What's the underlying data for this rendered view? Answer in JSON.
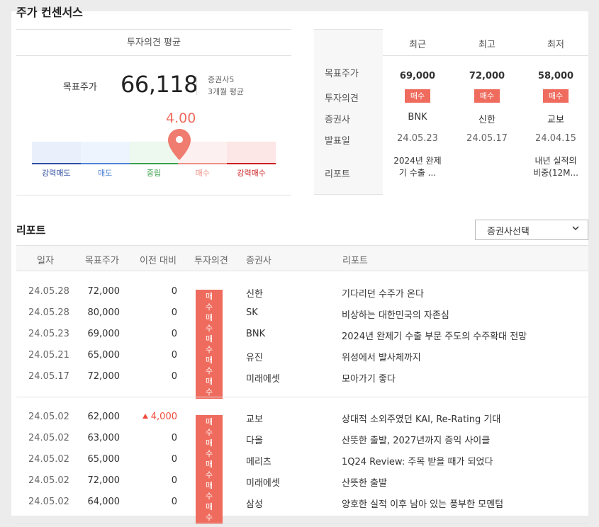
{
  "section_title": "주가 컨센서스",
  "consensus": {
    "header": "투자의견 평균",
    "target_label": "목표주가",
    "target_value": "66,118",
    "broker_count": "증권사5",
    "period": "3개월 평균",
    "score": "4.00",
    "score_fraction": 0.605,
    "scale": [
      {
        "label": "강력매도",
        "bg": "#e9f0fb",
        "line": "#2f4fa0",
        "text": "#2f4fa0"
      },
      {
        "label": "매도",
        "bg": "#edf4fd",
        "line": "#4f84d6",
        "text": "#4f84d6"
      },
      {
        "label": "중립",
        "bg": "#edf8ef",
        "line": "#3ba04e",
        "text": "#3ba04e"
      },
      {
        "label": "매수",
        "bg": "#fdf0f0",
        "line": "#ef8f86",
        "text": "#ef8f86"
      },
      {
        "label": "강력매수",
        "bg": "#fde6e6",
        "line": "#cc1f1f",
        "text": "#cc1f1f"
      }
    ]
  },
  "summary_table": {
    "columns": [
      "최근",
      "최고",
      "최저"
    ],
    "row_labels": [
      "목표주가",
      "투자의견",
      "증권사",
      "발표일",
      "리포트"
    ],
    "data": [
      {
        "target": "69,000",
        "opinion": "매수",
        "broker": "BNK",
        "date": "24.05.23",
        "report": "2024년 완제기 수출 ..."
      },
      {
        "target": "72,000",
        "opinion": "매수",
        "broker": "신한",
        "date": "24.05.17",
        "report": ""
      },
      {
        "target": "58,000",
        "opinion": "매수",
        "broker": "교보",
        "date": "24.04.15",
        "report": "내년 실적의 비중(12M..."
      }
    ]
  },
  "reports": {
    "title": "리포트",
    "filter_label": "증권사선택",
    "columns": [
      "일자",
      "목표주가",
      "이전 대비",
      "투자의견",
      "증권사",
      "리포트"
    ],
    "groups": [
      [
        {
          "date": "24.05.28",
          "target": "72,000",
          "diff": "0",
          "diff_up": false,
          "opinion": "매수",
          "broker": "신한",
          "title": "기다리던 수주가 온다"
        },
        {
          "date": "24.05.28",
          "target": "80,000",
          "diff": "0",
          "diff_up": false,
          "opinion": "매수",
          "broker": "SK",
          "title": "비상하는 대한민국의 자존심"
        },
        {
          "date": "24.05.23",
          "target": "69,000",
          "diff": "0",
          "diff_up": false,
          "opinion": "매수",
          "broker": "BNK",
          "title": "2024년 완제기 수출 부문 주도의 수주확대 전망"
        },
        {
          "date": "24.05.21",
          "target": "65,000",
          "diff": "0",
          "diff_up": false,
          "opinion": "매수",
          "broker": "유진",
          "title": "위성에서 발사체까지"
        },
        {
          "date": "24.05.17",
          "target": "72,000",
          "diff": "0",
          "diff_up": false,
          "opinion": "매수",
          "broker": "미래에셋",
          "title": "모아가기 좋다"
        }
      ],
      [
        {
          "date": "24.05.02",
          "target": "62,000",
          "diff": "4,000",
          "diff_up": true,
          "opinion": "매수",
          "broker": "교보",
          "title": "상대적 소외주였던 KAI, Re-Rating 기대"
        },
        {
          "date": "24.05.02",
          "target": "63,000",
          "diff": "0",
          "diff_up": false,
          "opinion": "매수",
          "broker": "다올",
          "title": "산뜻한 출발, 2027년까지 증익 사이클"
        },
        {
          "date": "24.05.02",
          "target": "65,000",
          "diff": "0",
          "diff_up": false,
          "opinion": "매수",
          "broker": "메리츠",
          "title": "1Q24 Review: 주목 받을 때가 되었다"
        },
        {
          "date": "24.05.02",
          "target": "72,000",
          "diff": "0",
          "diff_up": false,
          "opinion": "매수",
          "broker": "미래에셋",
          "title": "산뜻한 출발"
        },
        {
          "date": "24.05.02",
          "target": "64,000",
          "diff": "0",
          "diff_up": false,
          "opinion": "매수",
          "broker": "삼성",
          "title": "양호한 실적 이후 남아 있는 풍부한 모멘텀"
        }
      ]
    ]
  }
}
